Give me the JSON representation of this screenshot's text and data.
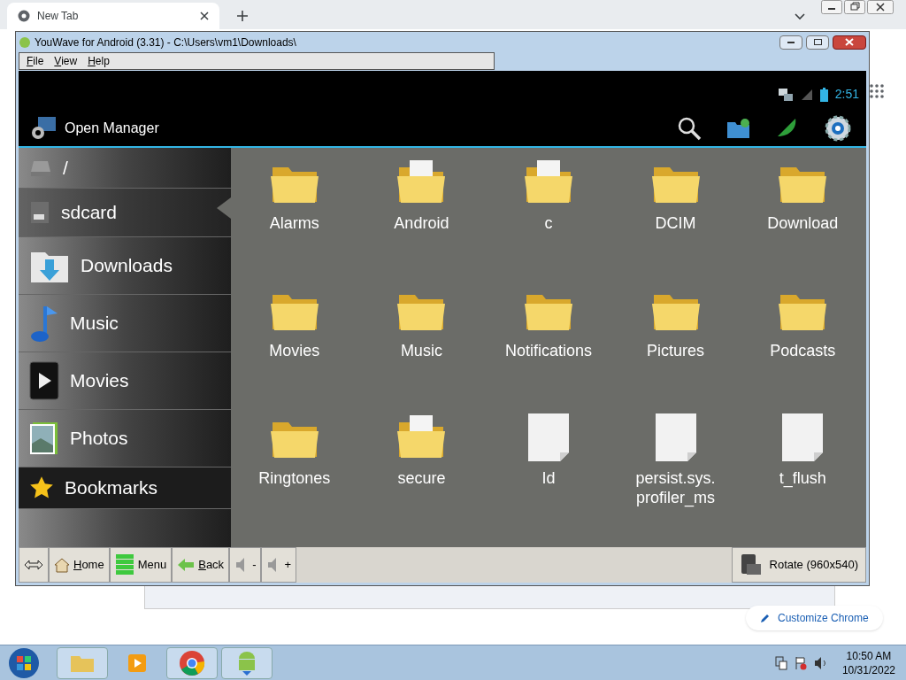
{
  "browser": {
    "tabs": [
      {
        "label": "New Tab",
        "selected": true
      }
    ],
    "customize": "Customize Chrome"
  },
  "window": {
    "title": "YouWave for Android (3.31) - C:\\Users\\vm1\\Downloads\\",
    "menu": [
      "File",
      "View",
      "Help"
    ]
  },
  "android": {
    "clock": "2:51",
    "app_title": "Open Manager",
    "sidebar": [
      {
        "label": "/",
        "kind": "drive",
        "selected": false
      },
      {
        "label": "sdcard",
        "kind": "sd",
        "selected": true
      },
      {
        "label": "Downloads",
        "kind": "downloads",
        "selected": false
      },
      {
        "label": "Music",
        "kind": "music",
        "selected": false
      },
      {
        "label": "Movies",
        "kind": "movies",
        "selected": false
      },
      {
        "label": "Photos",
        "kind": "photos",
        "selected": false
      },
      {
        "label": "Bookmarks",
        "kind": "bookmarks",
        "selected": false
      }
    ],
    "files": [
      {
        "name": "Alarms",
        "kind": "folder"
      },
      {
        "name": "Android",
        "kind": "folder_docs"
      },
      {
        "name": "c",
        "kind": "folder_docs"
      },
      {
        "name": "DCIM",
        "kind": "folder"
      },
      {
        "name": "Download",
        "kind": "folder"
      },
      {
        "name": "Movies",
        "kind": "folder"
      },
      {
        "name": "Music",
        "kind": "folder"
      },
      {
        "name": "Notifications",
        "kind": "folder"
      },
      {
        "name": "Pictures",
        "kind": "folder"
      },
      {
        "name": "Podcasts",
        "kind": "folder"
      },
      {
        "name": "Ringtones",
        "kind": "folder"
      },
      {
        "name": "secure",
        "kind": "folder_docs"
      },
      {
        "name": "Id",
        "kind": "file"
      },
      {
        "name": "persist.sys.\nprofiler_ms",
        "kind": "file"
      },
      {
        "name": "t_flush",
        "kind": "file"
      }
    ]
  },
  "toolbar": [
    {
      "kind": "resize"
    },
    {
      "kind": "home",
      "label": "Home"
    },
    {
      "kind": "menu",
      "label": "Menu"
    },
    {
      "kind": "back",
      "label": "Back"
    },
    {
      "kind": "vol",
      "label": "-"
    },
    {
      "kind": "vol",
      "label": "+"
    }
  ],
  "rotate": "Rotate (960x540)",
  "taskbar": {
    "time": "10:50 AM",
    "date": "10/31/2022"
  }
}
